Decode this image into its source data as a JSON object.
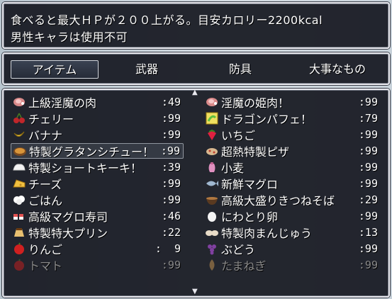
{
  "help": {
    "line1": "食べると最大ＨＰが２００上がる。目安カロリー2200kcal",
    "line2": "男性キャラは使用不可"
  },
  "tabs": [
    {
      "label": "アイテム",
      "selected": true
    },
    {
      "label": "武器",
      "selected": false
    },
    {
      "label": "防具",
      "selected": false
    },
    {
      "label": "大事なもの",
      "selected": false
    }
  ],
  "items_left": [
    {
      "name": "上級淫魔の肉",
      "qty": ":49",
      "icon": "meat-icon",
      "color": "#d98a8a"
    },
    {
      "name": "チェリー",
      "qty": ":99",
      "icon": "cherry-icon",
      "color": "#c0262a"
    },
    {
      "name": "バナナ",
      "qty": ":99",
      "icon": "banana-icon",
      "color": "#f2d040"
    },
    {
      "name": "特製グラタンシチュー！",
      "qty": ":99",
      "icon": "stew-icon",
      "color": "#d8953a",
      "selected": true
    },
    {
      "name": "特製ショートキーキ！",
      "qty": ":39",
      "icon": "cake-icon",
      "color": "#f4f4f4"
    },
    {
      "name": "チーズ",
      "qty": ":99",
      "icon": "cheese-icon",
      "color": "#f0c040"
    },
    {
      "name": "ごはん",
      "qty": ":99",
      "icon": "rice-icon",
      "color": "#ffffff"
    },
    {
      "name": "高級マグロ寿司",
      "qty": ":46",
      "icon": "sushi-icon",
      "color": "#e05050"
    },
    {
      "name": "特製特大プリン",
      "qty": ":22",
      "icon": "pudding-icon",
      "color": "#e8c070"
    },
    {
      "name": "りんご",
      "qty": ":  9",
      "icon": "apple-icon",
      "color": "#d02020"
    },
    {
      "name": "トマト",
      "qty": ":99",
      "icon": "tomato-icon",
      "color": "#c02020",
      "dim": true
    }
  ],
  "items_right": [
    {
      "name": "淫魔の姫肉！",
      "qty": ":99",
      "icon": "meat-icon",
      "color": "#d98a8a"
    },
    {
      "name": "ドラゴンパフェ！",
      "qty": ":79",
      "icon": "dragon-parfait-icon",
      "color": "#60c040"
    },
    {
      "name": "いちご",
      "qty": ":99",
      "icon": "strawberry-icon",
      "color": "#e02040"
    },
    {
      "name": "超熱特製ピザ",
      "qty": ":99",
      "icon": "pizza-icon",
      "color": "#d8b890"
    },
    {
      "name": "小麦",
      "qty": ":99",
      "icon": "wheat-icon",
      "color": "#e090c0"
    },
    {
      "name": "新鮮マグロ",
      "qty": ":99",
      "icon": "fish-icon",
      "color": "#a0b8d0"
    },
    {
      "name": "高級大盛りきつねそば",
      "qty": ":29",
      "icon": "soba-icon",
      "color": "#b07840"
    },
    {
      "name": "にわとり卵",
      "qty": ":99",
      "icon": "egg-icon",
      "color": "#f4f4f4"
    },
    {
      "name": "特製肉まんじゅう",
      "qty": ":13",
      "icon": "bun-icon",
      "color": "#e8dcc8"
    },
    {
      "name": "ぶどう",
      "qty": ":99",
      "icon": "grape-icon",
      "color": "#8040a0"
    },
    {
      "name": "たまねぎ",
      "qty": ":99",
      "icon": "onion-icon",
      "color": "#c09050",
      "dim": true
    }
  ]
}
